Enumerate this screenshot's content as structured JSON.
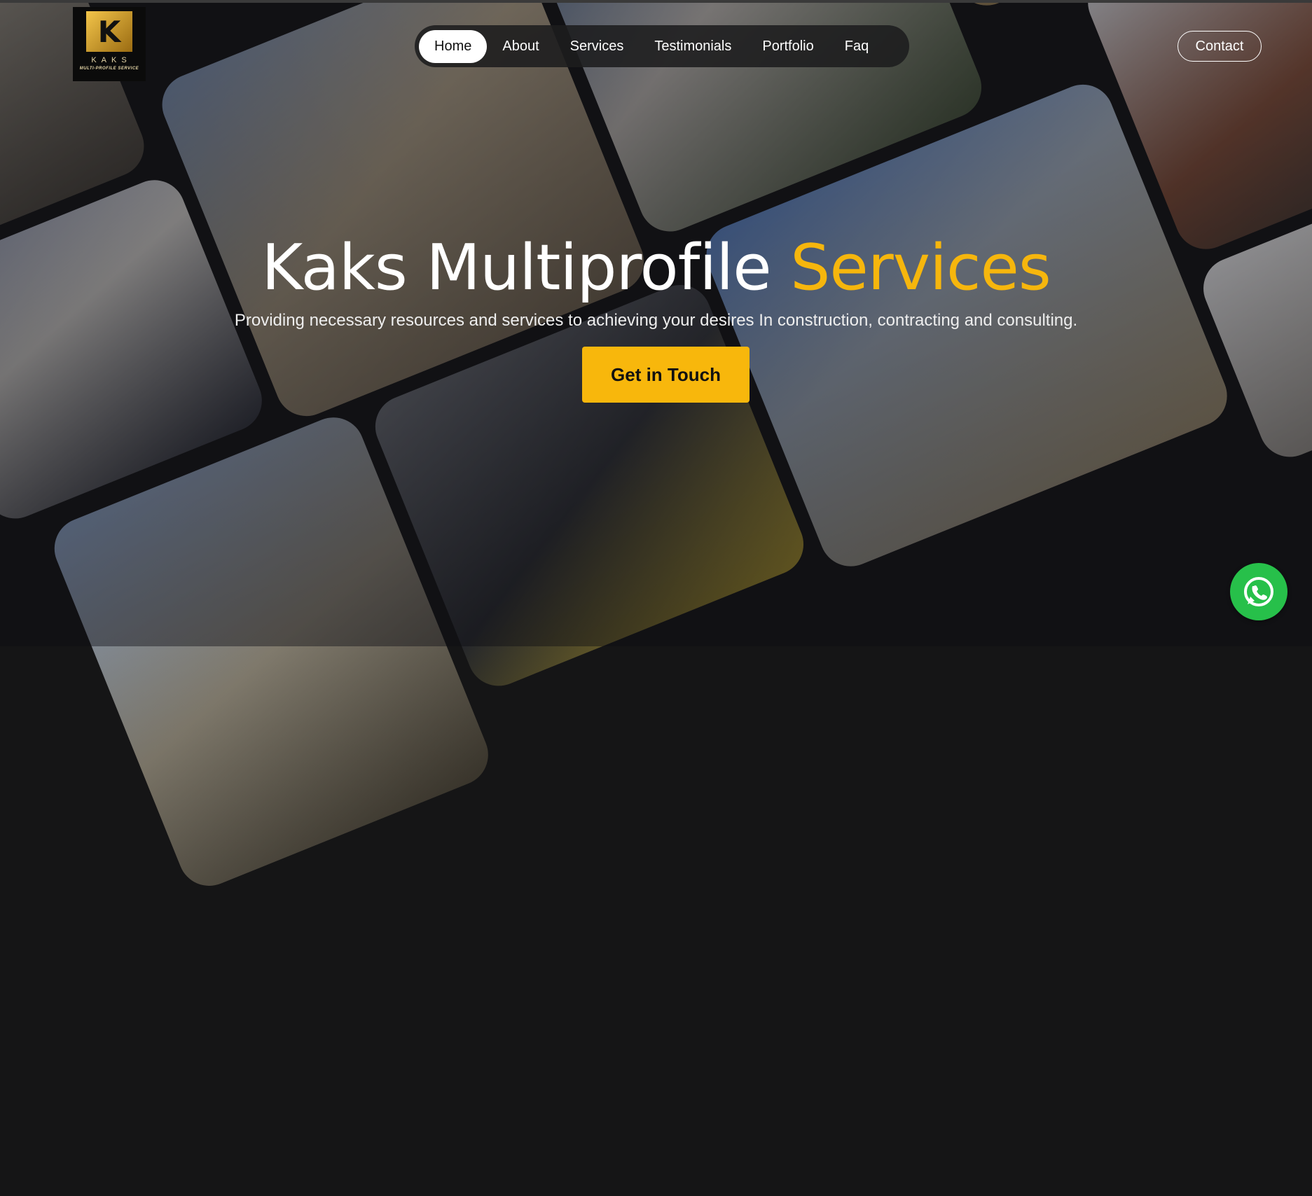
{
  "logo": {
    "wordmark": "KAKS",
    "tagline": "MULTI-PROFILE SERVICE",
    "mark_letter": "K"
  },
  "nav": {
    "items": [
      {
        "label": "Home",
        "active": true
      },
      {
        "label": "About"
      },
      {
        "label": "Services"
      },
      {
        "label": "Testimonials"
      },
      {
        "label": "Portfolio"
      },
      {
        "label": "Faq"
      }
    ]
  },
  "contact_label": "Contact",
  "hero": {
    "title_main": "Kaks Multiprofile ",
    "title_accent": "Services",
    "subtitle": "Providing necessary resources and services to achieving your desires In construction, contracting and consulting.",
    "cta_label": "Get in Touch"
  },
  "icons": {
    "whatsapp": "whatsapp-icon"
  },
  "colors": {
    "accent": "#f6b60d",
    "whatsapp": "#27c04a",
    "background": "#151516"
  }
}
